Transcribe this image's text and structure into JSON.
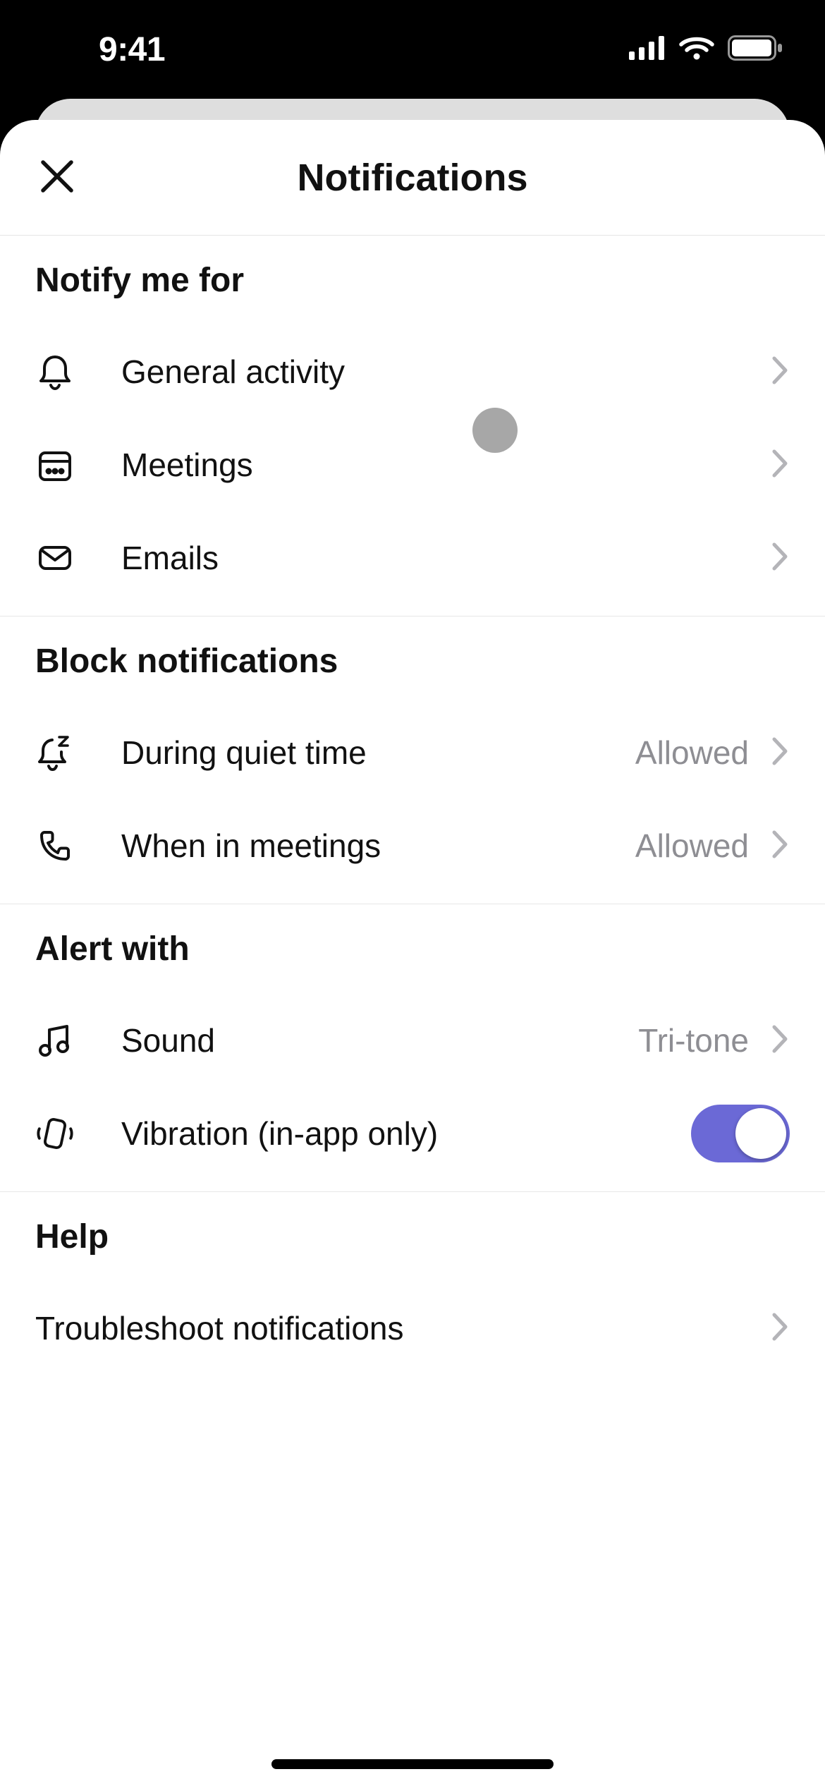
{
  "status": {
    "time": "9:41"
  },
  "header": {
    "title": "Notifications"
  },
  "sections": {
    "notify": {
      "title": "Notify me for",
      "items": [
        {
          "label": "General activity"
        },
        {
          "label": "Meetings"
        },
        {
          "label": "Emails"
        }
      ]
    },
    "block": {
      "title": "Block notifications",
      "items": [
        {
          "label": "During quiet time",
          "value": "Allowed"
        },
        {
          "label": "When in meetings",
          "value": "Allowed"
        }
      ]
    },
    "alert": {
      "title": "Alert with",
      "items": [
        {
          "label": "Sound",
          "value": "Tri-tone"
        },
        {
          "label": "Vibration (in-app only)",
          "toggle": true
        }
      ]
    },
    "help": {
      "title": "Help",
      "items": [
        {
          "label": "Troubleshoot notifications"
        }
      ]
    }
  }
}
